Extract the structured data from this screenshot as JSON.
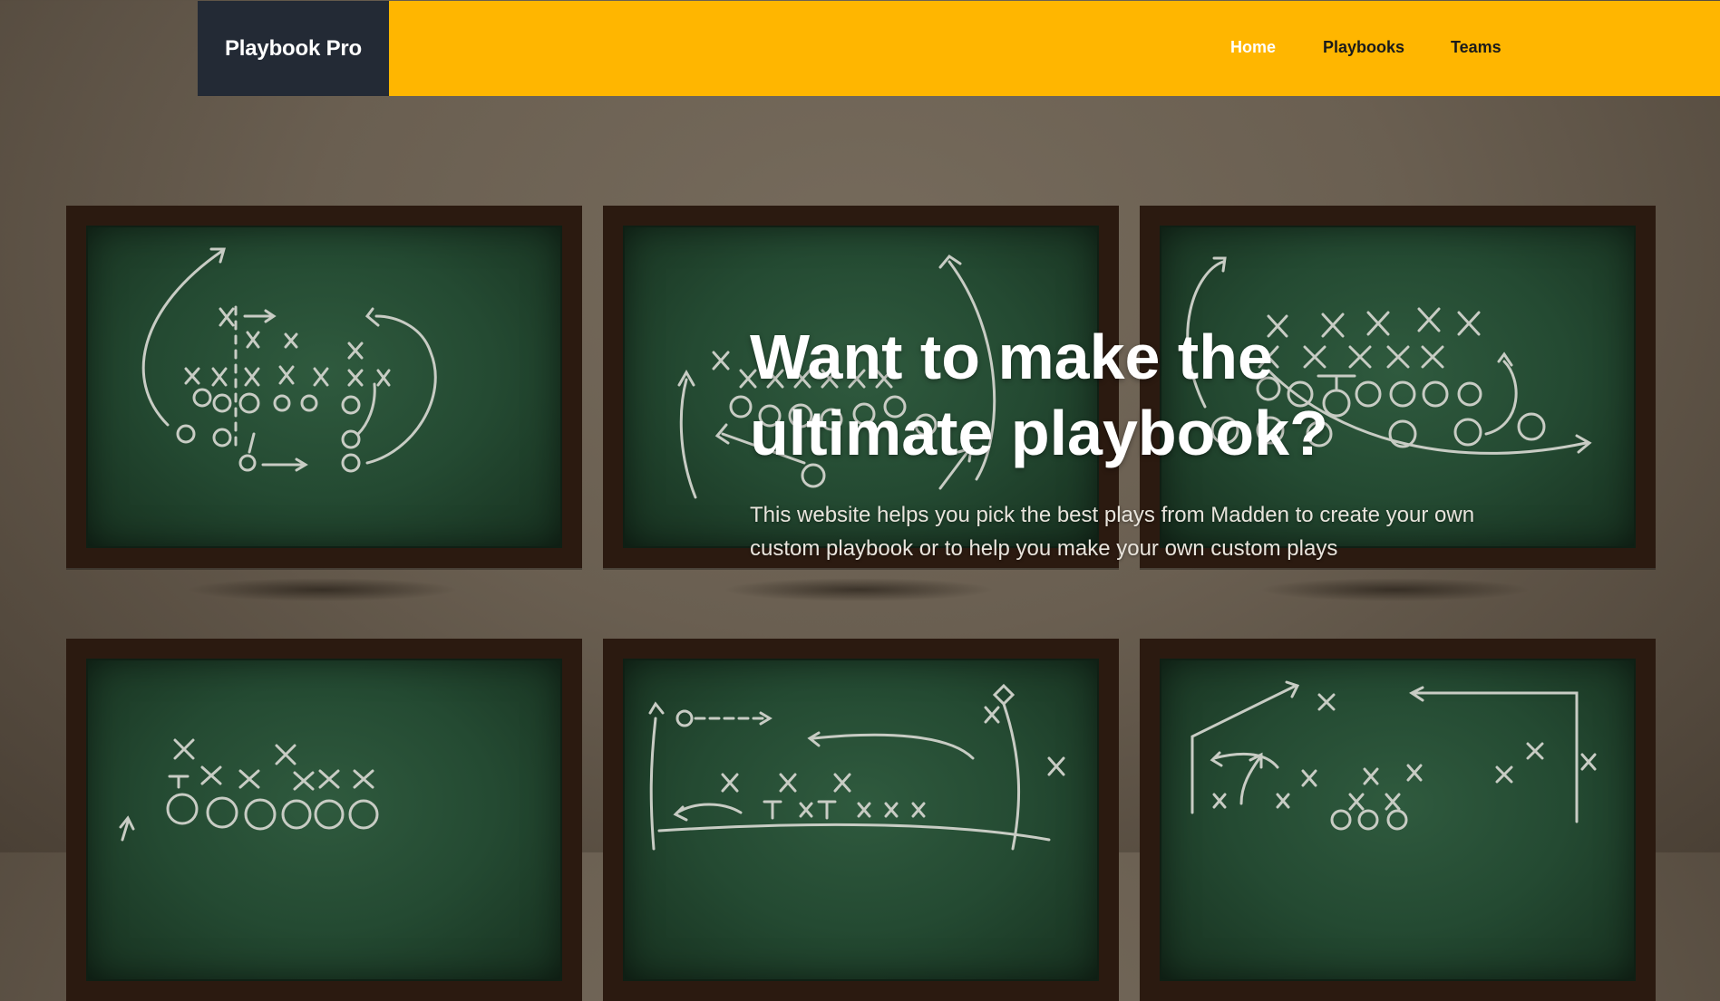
{
  "header": {
    "brand": "Playbook Pro",
    "nav": [
      {
        "label": "Home",
        "active": true
      },
      {
        "label": "Playbooks",
        "active": false
      },
      {
        "label": "Teams",
        "active": false
      }
    ]
  },
  "hero": {
    "title_line1": "Want to make the",
    "title_line2": "ultimate playbook?",
    "description_line1": "This website helps you pick the best plays from Madden to create your own",
    "description_line2": "custom playbook or to help you make your own custom plays"
  },
  "colors": {
    "header_bg": "#ffb600",
    "brand_bg": "#232a35",
    "nav_active": "#ffffff",
    "nav_text": "#1b1b1b",
    "chalkboard": "#244a32",
    "frame": "#2b1a10"
  }
}
